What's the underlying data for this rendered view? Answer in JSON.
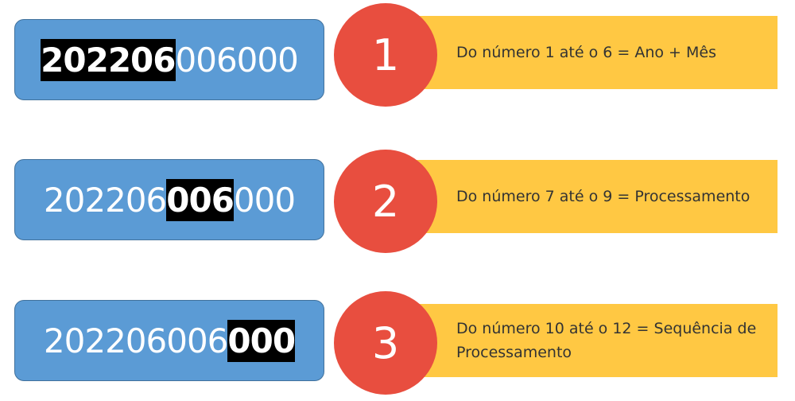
{
  "colors": {
    "code_box": "#5b9bd5",
    "code_box_border": "#41719c",
    "highlight": "#000000",
    "circle": "#e84e3f",
    "banner": "#ffc843"
  },
  "rows": [
    {
      "code": {
        "before": "",
        "highlight": "202206",
        "after": "006000"
      },
      "number": "1",
      "description": "Do número 1 até o 6 = Ano + Mês"
    },
    {
      "code": {
        "before": "202206",
        "highlight": "006",
        "after": "000"
      },
      "number": "2",
      "description": "Do número 7 até o 9 = Processamento"
    },
    {
      "code": {
        "before": "202206006",
        "highlight": "000",
        "after": ""
      },
      "number": "3",
      "description": "Do número 10 até o 12 = Sequência de Processamento"
    }
  ]
}
